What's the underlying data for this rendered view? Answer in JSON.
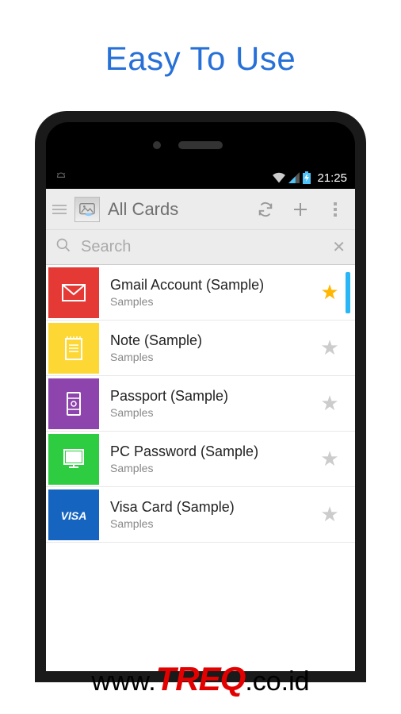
{
  "headline": "Easy To Use",
  "status": {
    "time": "21:25"
  },
  "appbar": {
    "title": "All Cards"
  },
  "search": {
    "placeholder": "Search"
  },
  "items": [
    {
      "title": "Gmail Account (Sample)",
      "sub": "Samples",
      "iconBg": "#e53935",
      "starred": true,
      "marker": "#29b6f6",
      "icon": "mail"
    },
    {
      "title": "Note (Sample)",
      "sub": "Samples",
      "iconBg": "#fdd835",
      "starred": false,
      "marker": "",
      "icon": "note"
    },
    {
      "title": "Passport (Sample)",
      "sub": "Samples",
      "iconBg": "#8e44ad",
      "starred": false,
      "marker": "",
      "icon": "passport"
    },
    {
      "title": "PC Password (Sample)",
      "sub": "Samples",
      "iconBg": "#2ecc40",
      "starred": false,
      "marker": "",
      "icon": "pc"
    },
    {
      "title": "Visa Card (Sample)",
      "sub": "Samples",
      "iconBg": "#1565c0",
      "starred": false,
      "marker": "",
      "icon": "visa"
    }
  ],
  "footer": {
    "pre": "www.",
    "brand": "TREQ",
    "post": ".co.id"
  }
}
